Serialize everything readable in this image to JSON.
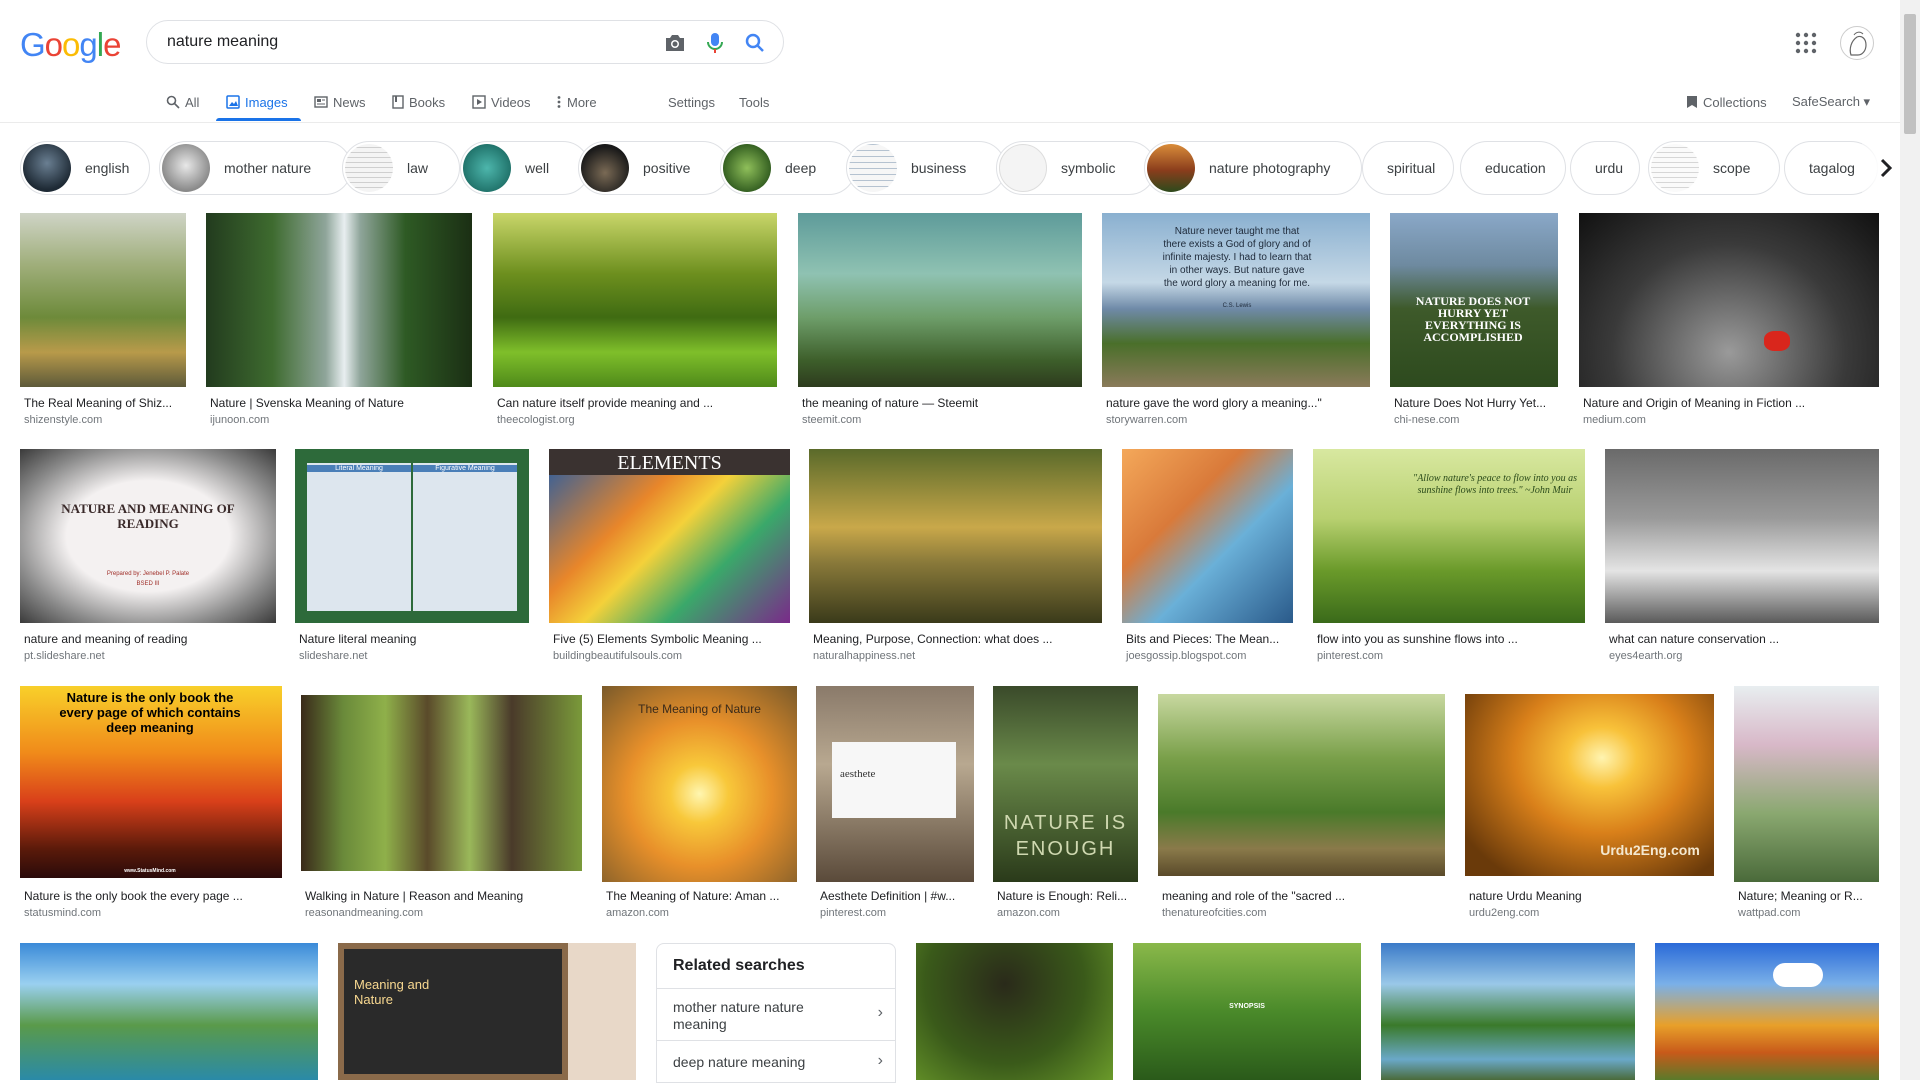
{
  "logo": "Google",
  "search": {
    "value": "nature meaning",
    "placeholder": ""
  },
  "tabs": [
    {
      "label": "All",
      "icon": "search-icon"
    },
    {
      "label": "Images",
      "icon": "image-icon"
    },
    {
      "label": "News",
      "icon": "news-icon"
    },
    {
      "label": "Books",
      "icon": "book-icon"
    },
    {
      "label": "Videos",
      "icon": "video-icon"
    },
    {
      "label": "More",
      "icon": "more-vert-icon"
    },
    {
      "label": "Settings"
    },
    {
      "label": "Tools"
    }
  ],
  "right_tabs": {
    "collections": "Collections",
    "safesearch": "SafeSearch ▾"
  },
  "chips": [
    "english",
    "mother nature",
    "law",
    "well",
    "positive",
    "deep",
    "business",
    "symbolic",
    "nature photography",
    "spiritual",
    "education",
    "urdu",
    "scope",
    "tagalog"
  ],
  "results": [
    {
      "caption": "The Real Meaning of Shiz...",
      "source": "shizenstyle.com"
    },
    {
      "caption": "Nature | Svenska Meaning of Nature",
      "source": "ijunoon.com"
    },
    {
      "caption": "Can nature itself provide meaning and ...",
      "source": "theecologist.org"
    },
    {
      "caption": "the meaning of nature — Steemit",
      "source": "steemit.com"
    },
    {
      "caption": "nature gave the word glory a meaning...\"",
      "source": "storywarren.com"
    },
    {
      "caption": "Nature Does Not Hurry Yet...",
      "source": "chi-nese.com"
    },
    {
      "caption": "Nature and Origin of Meaning in Fiction ...",
      "source": "medium.com"
    },
    {
      "caption": "nature and meaning of reading",
      "source": "pt.slideshare.net"
    },
    {
      "caption": "Nature literal meaning",
      "source": "slideshare.net"
    },
    {
      "caption": "Five (5) Elements Symbolic Meaning ...",
      "source": "buildingbeautifulsouls.com"
    },
    {
      "caption": "Meaning, Purpose, Connection: what does ...",
      "source": "naturalhappiness.net"
    },
    {
      "caption": "Bits and Pieces: The Mean...",
      "source": "joesgossip.blogspot.com"
    },
    {
      "caption": "flow into you as sunshine flows into ...",
      "source": "pinterest.com"
    },
    {
      "caption": "what can nature conservation ...",
      "source": "eyes4earth.org"
    },
    {
      "caption": "Nature is the only book the every page ...",
      "source": "statusmind.com"
    },
    {
      "caption": "Walking in Nature | Reason and Meaning",
      "source": "reasonandmeaning.com"
    },
    {
      "caption": "The Meaning of Nature: Aman ...",
      "source": "amazon.com"
    },
    {
      "caption": "Aesthete Definition | #w...",
      "source": "pinterest.com"
    },
    {
      "caption": "Nature is Enough: Reli...",
      "source": "amazon.com"
    },
    {
      "caption": "meaning and role of the \"sacred ...",
      "source": "thenatureofcities.com"
    },
    {
      "caption": "nature Urdu Meaning",
      "source": "urdu2eng.com"
    },
    {
      "caption": "Nature; Meaning or R...",
      "source": "wattpad.com"
    }
  ],
  "image_texts": {
    "quote_lewis": "Nature never taught me that there exists a God of glory and of infinite majesty. I had to learn that in other ways. But nature gave the word glory a meaning for me.",
    "quote_lewis_author": "C.S. Lewis",
    "hurry": "NATURE DOES NOT HURRY YET EVERYTHING IS ACCOMPLISHED",
    "reading_title": "NATURE AND MEANING OF READING",
    "reading_author": "Prepared by: Jenebel P. Palate",
    "reading_degree": "BSED III",
    "literal_h1": "Literal Meaning",
    "literal_h2": "Figurative Meaning",
    "elements": "ELEMENTS",
    "muir": "\"Allow nature's peace to flow into you as sunshine flows into trees.\" ~John Muir",
    "only_book": "Nature is the only book the every page of which contains deep meaning",
    "statusmind": "www.StatusMind.com",
    "meaning_of_nature": "The Meaning of Nature",
    "aesthete": "aesthete",
    "enough": "NATURE IS ENOUGH",
    "urdu2eng": "Urdu2Eng.com",
    "meaning_and_nature": "Meaning and Nature",
    "synopsis": "SYNOPSIS"
  },
  "related": {
    "title": "Related searches",
    "items": [
      "mother nature nature meaning",
      "deep nature meaning"
    ]
  }
}
